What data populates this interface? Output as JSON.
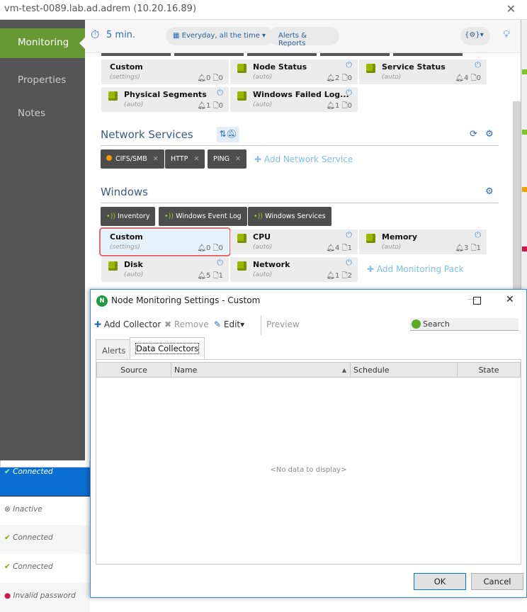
{
  "window": {
    "title": "vm-test-0089.lab.ad.adrem (10.20.16.89)"
  },
  "sidebar": {
    "items": [
      {
        "label": "Monitoring",
        "active": true
      },
      {
        "label": "Properties"
      },
      {
        "label": "Notes"
      }
    ]
  },
  "header": {
    "interval": "5 min.",
    "schedule": "Everyday, all the time",
    "alerts_reports": "Alerts & Reports",
    "settings_icon": "{⚙}"
  },
  "packs_top": [
    {
      "name": "Custom",
      "sub": "(settings)",
      "alerts": "0",
      "docs": "0",
      "icon": false
    },
    {
      "name": "Node Status",
      "sub": "(auto)",
      "alerts": "2",
      "docs": "0",
      "icon": true
    },
    {
      "name": "Service Status",
      "sub": "(auto)",
      "alerts": "4",
      "docs": "0",
      "icon": true
    },
    {
      "name": "Physical Segments",
      "sub": "(auto)",
      "alerts": "1",
      "docs": "0",
      "icon": true
    },
    {
      "name": "Windows Failed Log...",
      "sub": "(auto)",
      "alerts": "1",
      "docs": "0",
      "icon": true
    }
  ],
  "network_services": {
    "title": "Network Services",
    "chips": [
      {
        "label": "CIFS/SMB",
        "status_color": "#f59a00"
      },
      {
        "label": "HTTP"
      },
      {
        "label": "PING"
      }
    ],
    "add": "Add Network Service"
  },
  "windows": {
    "title": "Windows",
    "chips": [
      "Inventory",
      "Windows Event Log",
      "Windows Services"
    ],
    "packs": [
      {
        "name": "Custom",
        "sub": "(settings)",
        "alerts": "0",
        "docs": "0",
        "icon": false,
        "selected": true
      },
      {
        "name": "CPU",
        "sub": "(auto)",
        "alerts": "4",
        "docs": "1",
        "icon": true
      },
      {
        "name": "Memory",
        "sub": "(auto)",
        "alerts": "3",
        "docs": "1",
        "icon": true
      },
      {
        "name": "Disk",
        "sub": "(auto)",
        "alerts": "5",
        "docs": "1",
        "icon": true
      },
      {
        "name": "Network",
        "sub": "(auto)",
        "alerts": "1",
        "docs": "2",
        "icon": true
      }
    ],
    "add": "Add Monitoring Pack"
  },
  "background_list": [
    "Connected",
    "Inactive",
    "Connected",
    "Connected",
    "Invalid password"
  ],
  "dialog": {
    "title": "Node Monitoring Settings - Custom",
    "toolbar": {
      "add": "Add Collector",
      "remove": "Remove",
      "edit": "Edit",
      "preview": "Preview",
      "search_placeholder": "Search"
    },
    "tabs": [
      "Alerts",
      "Data Collectors"
    ],
    "active_tab": "Data Collectors",
    "columns": [
      "Source",
      "Name",
      "Schedule",
      "State"
    ],
    "empty": "<No data to display>",
    "ok": "OK",
    "cancel": "Cancel"
  },
  "colors": {
    "accent": "#669933",
    "link": "#2a6db5",
    "highlight": "#e9656a"
  }
}
